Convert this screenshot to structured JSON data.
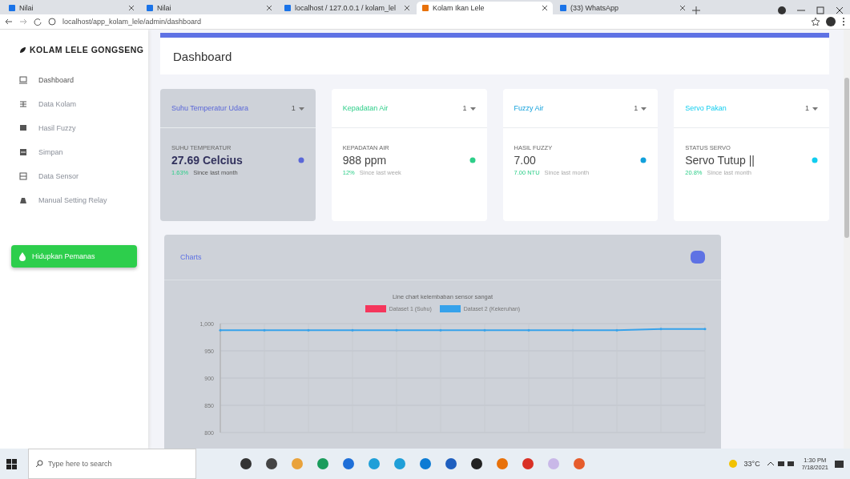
{
  "browser": {
    "tabs": [
      {
        "title": "Nilai",
        "selected": false
      },
      {
        "title": "Nilai",
        "selected": false
      },
      {
        "title": "localhost / 127.0.0.1 / kolam_lel",
        "selected": false
      },
      {
        "title": "Kolam Ikan Lele",
        "selected": true
      },
      {
        "title": "(33) WhatsApp",
        "selected": false
      }
    ],
    "url": "localhost/app_kolam_lele/admin/dashboard"
  },
  "sidebar": {
    "brand": "KOLAM LELE GONGSENG",
    "items": [
      {
        "label": "Dashboard",
        "selected": true
      },
      {
        "label": "Data Kolam",
        "selected": false
      },
      {
        "label": "Hasil Fuzzy",
        "selected": false
      },
      {
        "label": "Simpan",
        "selected": false
      },
      {
        "label": "Data Sensor",
        "selected": false
      },
      {
        "label": "Manual Setting Relay",
        "selected": false
      }
    ],
    "button": "Hidupkan Pemanas"
  },
  "header": {
    "title": "Dashboard"
  },
  "cards": [
    {
      "title": "Suhu Temperatur Udara",
      "count": "1",
      "label": "SUHU TEMPERATUR",
      "value": "27.69 Celcius",
      "change": "1.63%",
      "note": "Since last month",
      "color": "#5a67d8",
      "dimmed": true
    },
    {
      "title": "Kepadatan Air",
      "count": "1",
      "label": "KEPADATAN AIR",
      "value": "988 ppm",
      "change": "12%",
      "note": "Since last week",
      "color": "#2dce89",
      "dimmed": false
    },
    {
      "title": "Fuzzy Air",
      "count": "1",
      "label": "HASIL FUZZY",
      "value": "7.00",
      "change": "7.00 NTU",
      "note": "Since last month",
      "color": "#11a0db",
      "dimmed": false
    },
    {
      "title": "Servo Pakan",
      "count": "1",
      "label": "STATUS SERVO",
      "value": "Servo Tutup ||",
      "change": "20.8%",
      "note": "Since last month",
      "color": "#11cdef",
      "dimmed": false
    }
  ],
  "charts_panel": {
    "title": "Charts",
    "dimmed": true,
    "chart_data": {
      "type": "line",
      "title": "Line chart kelembaban sensor sangat",
      "yticks": [
        800,
        850,
        900,
        950,
        {
          "value": 1000,
          "label": "1,000"
        }
      ],
      "ylim": [
        800,
        1000
      ],
      "grid": true,
      "series": [
        {
          "name": "Dataset 1 (Suhu)",
          "color": "#f5365c",
          "values": [
            null,
            null,
            null,
            null,
            null,
            null,
            null,
            null,
            null,
            null,
            null,
            null
          ]
        },
        {
          "name": "Dataset 2 (Kekeruhan)",
          "color": "#36a2eb",
          "values": [
            988,
            988,
            988,
            988,
            988,
            988,
            988,
            988,
            988,
            988,
            990,
            990
          ]
        }
      ]
    }
  },
  "taskbar": {
    "search_placeholder": "Type here to search",
    "weather": "33°C",
    "time": "1:30 PM",
    "date": "7/18/2021"
  }
}
